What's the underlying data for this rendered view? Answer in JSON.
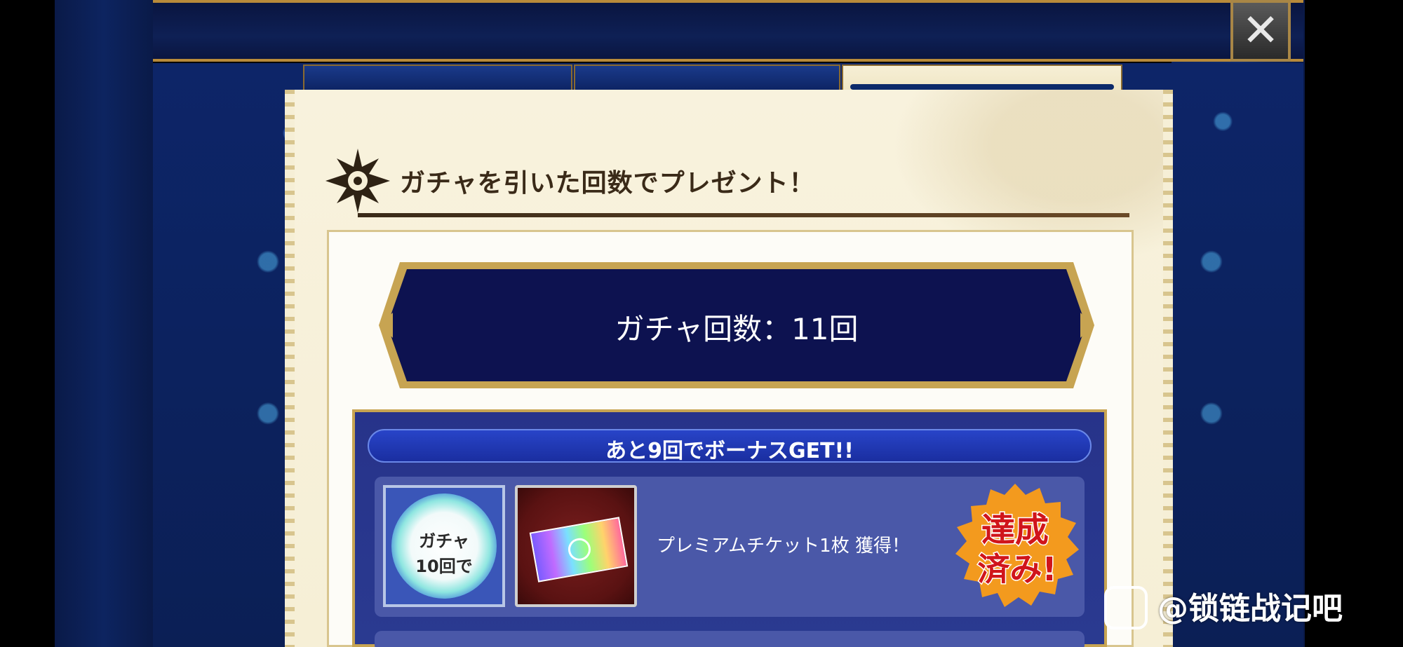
{
  "close_button": {
    "label": "✕"
  },
  "section": {
    "title": "ガチャを引いた回数でプレゼント！"
  },
  "count_banner": {
    "text": "ガチャ回数：11回"
  },
  "bonus": {
    "header": "あと9回でボーナスGET!!"
  },
  "reward": {
    "orb_text_line1": "ガチャ",
    "orb_text_line2": "10回で",
    "label": "プレミアムチケット1枚 獲得！",
    "stamp_line1": "達成",
    "stamp_line2": "済み!"
  },
  "watermark": {
    "text": "@锁链战记吧"
  },
  "colors": {
    "accent_gold": "#c7a452",
    "panel_blue": "#27338a",
    "paper": "#f6efd6",
    "stamp_orange": "#f39a1e",
    "stamp_red": "#d0151b"
  },
  "icons": {
    "close": "close-icon",
    "section": "snowflake-emblem-icon",
    "ticket": "premium-ticket-icon",
    "orb": "gacha-orb-icon"
  }
}
